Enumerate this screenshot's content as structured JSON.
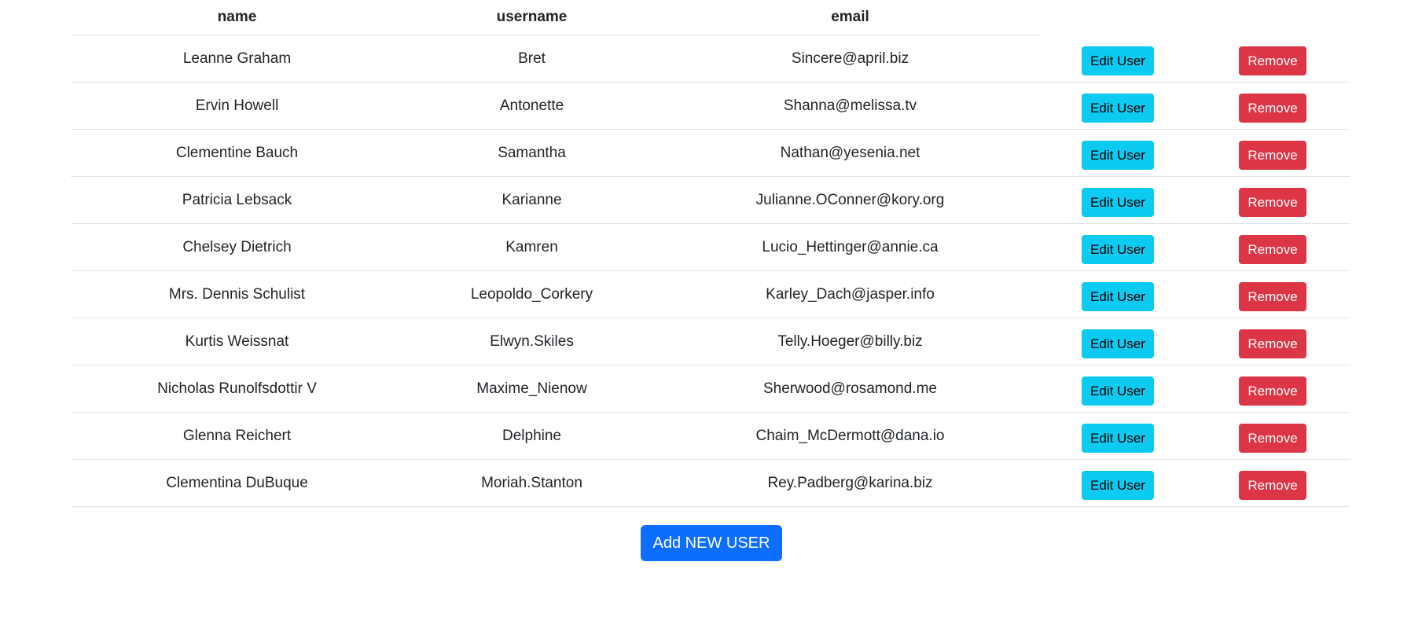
{
  "table": {
    "headers": [
      "name",
      "username",
      "email"
    ],
    "edit_label": "Edit User",
    "remove_label": "Remove",
    "rows": [
      {
        "name": "Leanne Graham",
        "username": "Bret",
        "email": "Sincere@april.biz"
      },
      {
        "name": "Ervin Howell",
        "username": "Antonette",
        "email": "Shanna@melissa.tv"
      },
      {
        "name": "Clementine Bauch",
        "username": "Samantha",
        "email": "Nathan@yesenia.net"
      },
      {
        "name": "Patricia Lebsack",
        "username": "Karianne",
        "email": "Julianne.OConner@kory.org"
      },
      {
        "name": "Chelsey Dietrich",
        "username": "Kamren",
        "email": "Lucio_Hettinger@annie.ca"
      },
      {
        "name": "Mrs. Dennis Schulist",
        "username": "Leopoldo_Corkery",
        "email": "Karley_Dach@jasper.info"
      },
      {
        "name": "Kurtis Weissnat",
        "username": "Elwyn.Skiles",
        "email": "Telly.Hoeger@billy.biz"
      },
      {
        "name": "Nicholas Runolfsdottir V",
        "username": "Maxime_Nienow",
        "email": "Sherwood@rosamond.me"
      },
      {
        "name": "Glenna Reichert",
        "username": "Delphine",
        "email": "Chaim_McDermott@dana.io"
      },
      {
        "name": "Clementina DuBuque",
        "username": "Moriah.Stanton",
        "email": "Rey.Padberg@karina.biz"
      }
    ]
  },
  "add_button_label": "Add NEW USER",
  "colors": {
    "edit": "#0dcaf0",
    "remove": "#dc3545",
    "add": "#0d6efd",
    "border": "#dee2e6"
  }
}
